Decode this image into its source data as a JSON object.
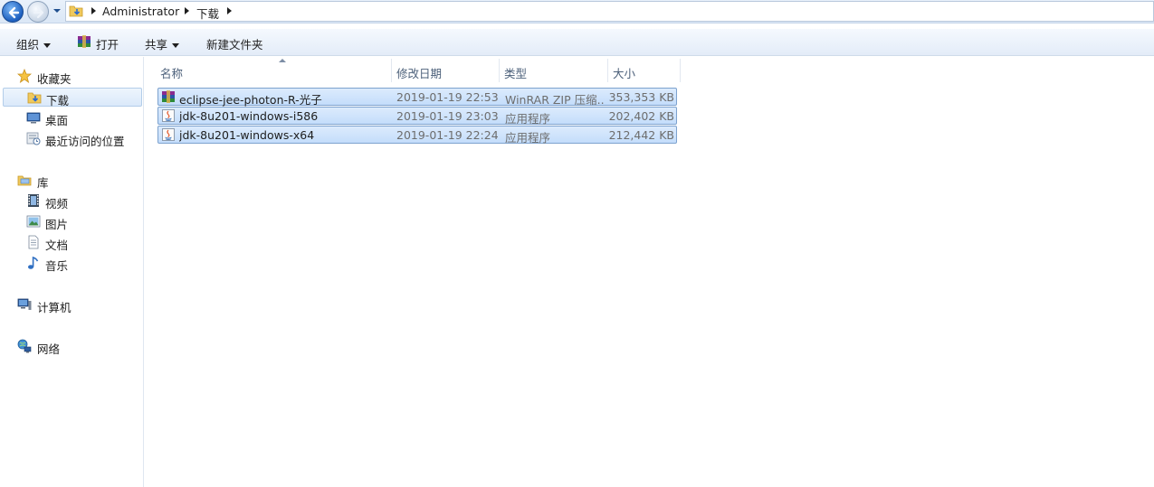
{
  "address": {
    "crumbs": [
      "Administrator",
      "下载"
    ]
  },
  "toolbar": {
    "organize": "组织",
    "open": "打开",
    "share": "共享",
    "new_folder": "新建文件夹"
  },
  "nav": {
    "favorites": {
      "label": "收藏夹",
      "icon": "star-icon"
    },
    "items_favorites": [
      {
        "label": "下载",
        "icon": "download-folder-icon",
        "selected": true
      },
      {
        "label": "桌面",
        "icon": "desktop-icon"
      },
      {
        "label": "最近访问的位置",
        "icon": "recent-places-icon"
      }
    ],
    "libraries": {
      "label": "库",
      "icon": "library-icon"
    },
    "items_libraries": [
      {
        "label": "视频",
        "icon": "video-icon"
      },
      {
        "label": "图片",
        "icon": "picture-icon"
      },
      {
        "label": "文档",
        "icon": "document-icon"
      },
      {
        "label": "音乐",
        "icon": "music-icon"
      }
    ],
    "computer": {
      "label": "计算机",
      "icon": "computer-icon"
    },
    "network": {
      "label": "网络",
      "icon": "network-icon"
    }
  },
  "columns": {
    "name": "名称",
    "date": "修改日期",
    "type": "类型",
    "size": "大小"
  },
  "files": [
    {
      "name": "eclipse-jee-photon-R-光子",
      "date": "2019-01-19 22:53",
      "type": "WinRAR ZIP 压缩...",
      "size": "353,353 KB",
      "icon": "winrar-archive-icon"
    },
    {
      "name": "jdk-8u201-windows-i586",
      "date": "2019-01-19 23:03",
      "type": "应用程序",
      "size": "202,402 KB",
      "icon": "java-installer-icon"
    },
    {
      "name": "jdk-8u201-windows-x64",
      "date": "2019-01-19 22:24",
      "type": "应用程序",
      "size": "212,442 KB",
      "icon": "java-installer-icon"
    }
  ],
  "colors": {
    "selection_fill": "#cce0fa",
    "selection_border": "#7da2ce",
    "header_text": "#4c607a"
  }
}
